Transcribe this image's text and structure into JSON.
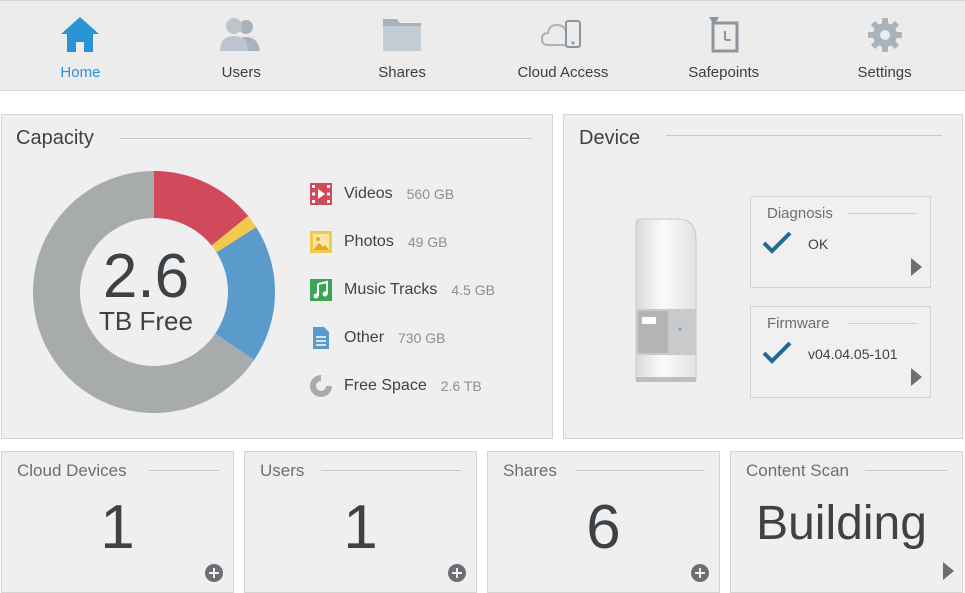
{
  "nav": {
    "items": [
      {
        "label": "Home",
        "icon": "home-icon",
        "active": true
      },
      {
        "label": "Users",
        "icon": "users-icon",
        "active": false
      },
      {
        "label": "Shares",
        "icon": "folder-icon",
        "active": false
      },
      {
        "label": "Cloud Access",
        "icon": "cloud-device-icon",
        "active": false
      },
      {
        "label": "Safepoints",
        "icon": "safepoint-icon",
        "active": false
      },
      {
        "label": "Settings",
        "icon": "gear-icon",
        "active": false
      }
    ],
    "active_color": "#2a93d5"
  },
  "capacity": {
    "title": "Capacity",
    "free_value": "2.6",
    "free_label": "TB Free",
    "legend": [
      {
        "name": "Videos",
        "value": "560 GB",
        "icon": "video-icon",
        "color": "#d14a5b"
      },
      {
        "name": "Photos",
        "value": "49 GB",
        "icon": "photo-icon",
        "color": "#f2c94c"
      },
      {
        "name": "Music Tracks",
        "value": "4.5 GB",
        "icon": "music-icon",
        "color": "#3aa655"
      },
      {
        "name": "Other",
        "value": "730 GB",
        "icon": "document-icon",
        "color": "#5a9bcc"
      },
      {
        "name": "Free Space",
        "value": "2.6 TB",
        "icon": "pie-icon",
        "color": "#a7abab"
      }
    ],
    "donut": {
      "segments": [
        {
          "name": "Videos",
          "fraction": 0.142,
          "color": "#d14a5b"
        },
        {
          "name": "Photos",
          "fraction": 0.018,
          "color": "#f2c94c"
        },
        {
          "name": "Other",
          "fraction": 0.185,
          "color": "#5a9bcc"
        },
        {
          "name": "Free Space",
          "fraction": 0.655,
          "color": "#a7abab"
        }
      ]
    }
  },
  "device": {
    "title": "Device",
    "diagnosis": {
      "title": "Diagnosis",
      "status": "OK"
    },
    "firmware": {
      "title": "Firmware",
      "version": "v04.04.05-101"
    },
    "check_color": "#1f6b94"
  },
  "tiles": [
    {
      "title": "Cloud Devices",
      "value": "1"
    },
    {
      "title": "Users",
      "value": "1"
    },
    {
      "title": "Shares",
      "value": "6"
    },
    {
      "title": "Content Scan",
      "value": "Building"
    }
  ]
}
